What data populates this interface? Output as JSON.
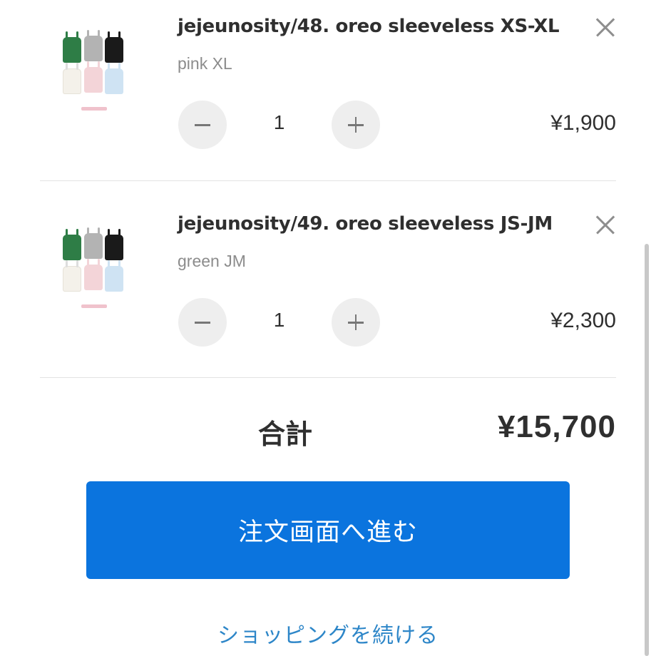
{
  "cart": {
    "items": [
      {
        "title": "jejeunosity/48. oreo sleeveless XS-XL",
        "variant": "pink XL",
        "quantity": "1",
        "price": "¥1,900",
        "thumbnail_colors": [
          "#2e7d46",
          "#b3b3b3",
          "#1a1a1a",
          "#f4f1ea",
          "#f3d4d8",
          "#cfe3f3"
        ]
      },
      {
        "title": "jejeunosity/49. oreo sleeveless JS-JM",
        "variant": "green JM",
        "quantity": "1",
        "price": "¥2,300",
        "thumbnail_colors": [
          "#2e7d46",
          "#b3b3b3",
          "#1a1a1a",
          "#f4f1ea",
          "#f3d4d8",
          "#cfe3f3"
        ]
      }
    ],
    "icons": {
      "remove": "close-icon",
      "decrease": "minus-icon",
      "increase": "plus-icon"
    }
  },
  "summary": {
    "total_label": "合計",
    "total_value": "¥15,700"
  },
  "actions": {
    "checkout_label": "注文画面へ進む",
    "continue_label": "ショッピングを続ける"
  },
  "colors": {
    "primary": "#0b74de",
    "link": "#2d86c8",
    "text": "#2f2f2f",
    "muted": "#8c8c8c"
  }
}
